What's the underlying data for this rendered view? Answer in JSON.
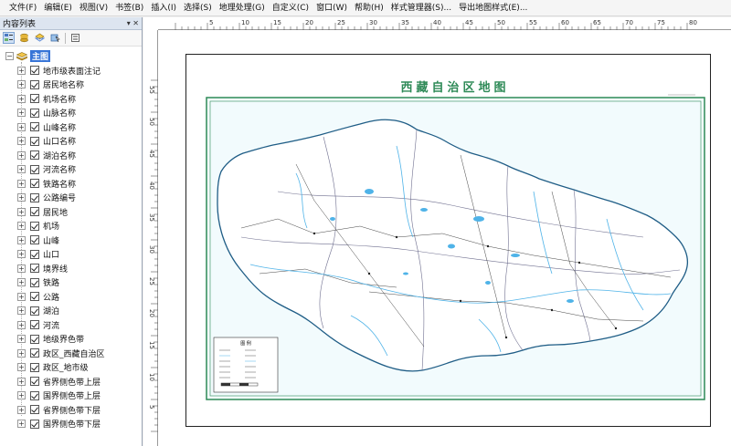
{
  "menu": [
    "文件(F)",
    "编辑(E)",
    "视图(V)",
    "书签(B)",
    "插入(I)",
    "选择(S)",
    "地理处理(G)",
    "自定义(C)",
    "窗口(W)",
    "帮助(H)",
    "样式管理器(S)...",
    "导出地图样式(E)..."
  ],
  "toc": {
    "title": "内容列表",
    "header_buttons": "▾ ✕",
    "root": "主图",
    "layers": [
      "地市级表面注记",
      "居民地名称",
      "机场名称",
      "山脉名称",
      "山峰名称",
      "山口名称",
      "湖泊名称",
      "河流名称",
      "铁路名称",
      "公路编号",
      "居民地",
      "机场",
      "山峰",
      "山口",
      "境界线",
      "铁路",
      "公路",
      "湖泊",
      "河流",
      "地级界色带",
      "政区_西藏自治区",
      "政区_地市级",
      "省界侧色带上层",
      "国界侧色带上层",
      "省界侧色带下层",
      "国界侧色带下层"
    ]
  },
  "ruler": {
    "top_ticks": [
      "5",
      "10",
      "15",
      "20",
      "25",
      "30",
      "35",
      "40",
      "45",
      "50",
      "55",
      "60",
      "65",
      "70",
      "75",
      "80"
    ],
    "left_ticks": [
      "55",
      "50",
      "45",
      "40",
      "35",
      "30",
      "25",
      "20",
      "15",
      "10",
      "5"
    ]
  },
  "map": {
    "title": "西藏自治区地图",
    "legend_title": "图 例"
  },
  "colors": {
    "accent": "#3875d7",
    "river": "#4fb3e8",
    "frame": "#2e8a57"
  }
}
